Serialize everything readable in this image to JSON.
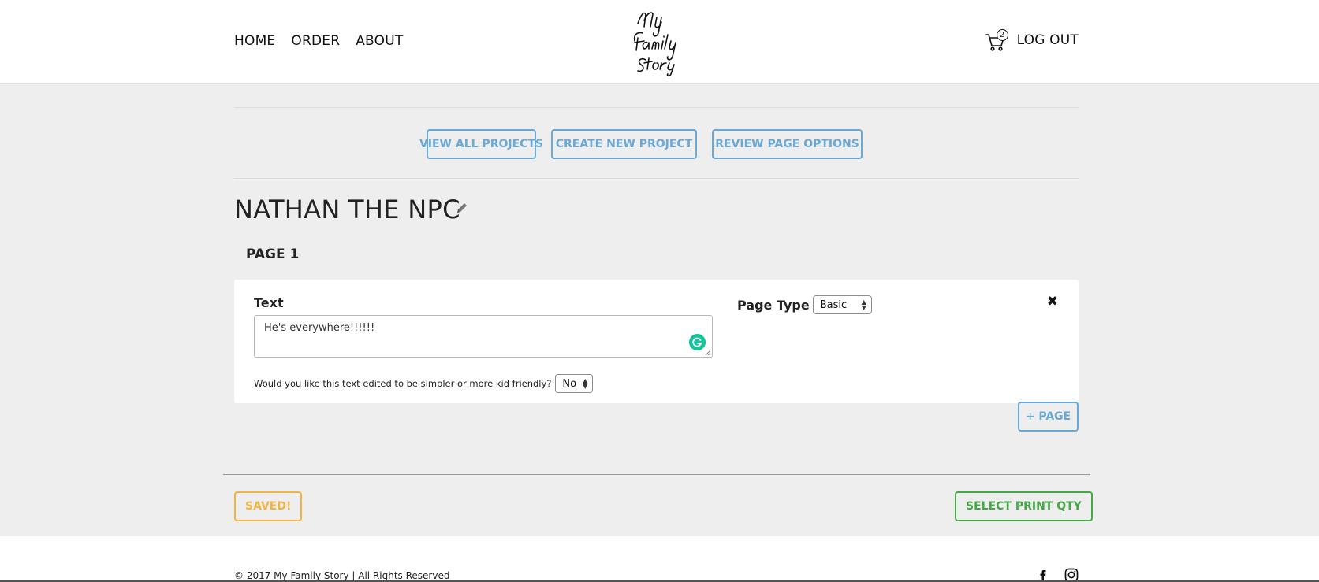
{
  "header": {
    "nav": [
      {
        "label": "HOME"
      },
      {
        "label": "ORDER"
      },
      {
        "label": "ABOUT"
      }
    ],
    "logo_text": "My Family Story",
    "cart_count": "2",
    "logout_label": "LOG OUT"
  },
  "actions": {
    "view_all": "VIEW ALL PROJECTS",
    "create_new": "CREATE NEW PROJECT",
    "review_options": "REVIEW PAGE OPTIONS"
  },
  "project": {
    "title": "NATHAN THE NPC"
  },
  "page": {
    "label": "PAGE 1",
    "text_label": "Text",
    "text_value": "He's everywhere!!!!!!",
    "kid_question": "Would you like this text edited to be simpler or more kid friendly?",
    "kid_value": "No",
    "page_type_label": "Page Type",
    "page_type_value": "Basic"
  },
  "add_page_label": "+ PAGE",
  "saved_label": "SAVED!",
  "print_label": "SELECT PRINT QTY",
  "footer": {
    "copyright": "© 2017 My Family Story | All Rights Reserved"
  },
  "colors": {
    "accent_blue": "#6aa9d6",
    "saved_orange": "#f5b342",
    "print_green": "#43a845",
    "grammarly": "#15c39a"
  },
  "icons": [
    "pencil-icon",
    "close-icon",
    "cart-icon",
    "grammarly-icon",
    "facebook-icon",
    "instagram-icon"
  ]
}
